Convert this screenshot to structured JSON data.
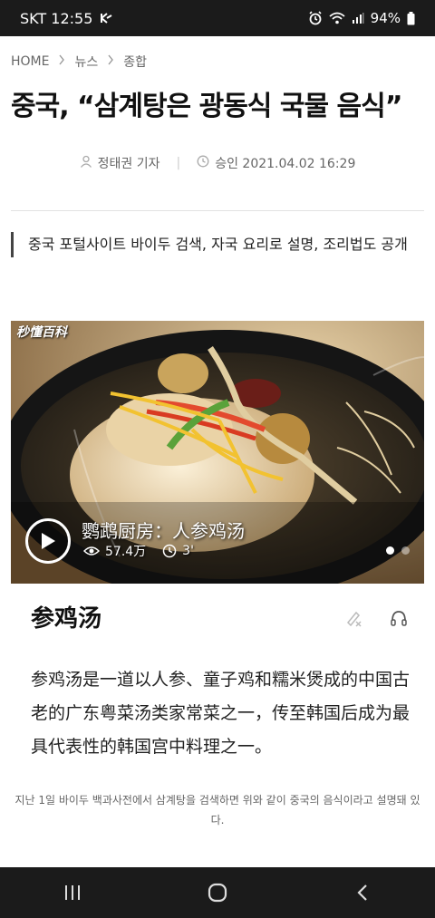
{
  "status_bar": {
    "carrier_time": "SKT 12:55",
    "battery": "94%"
  },
  "breadcrumb": [
    "HOME",
    "뉴스",
    "종합"
  ],
  "article": {
    "headline": "중국, “삼계탕은 광동식 국물 음식”",
    "author": "정태권 기자",
    "approved": "승인 2021.04.02 16:29",
    "subtitle": "중국 포털사이트 바이두 검색, 자국 요리로 설명, 조리법도 공개"
  },
  "video": {
    "logo": "秒懂百科",
    "title": "鹦鹉厨房：人参鸡汤",
    "views": "57.4万",
    "duration": "3'",
    "slide_count": 2,
    "active_slide": 1
  },
  "baike": {
    "title": "参鸡汤",
    "body": "参鸡汤是一道以人参、童子鸡和糯米煲成的中国古老的广东粤菜汤类家常菜之一，传至韩国后成为最具代表性的韩国宫中料理之一。"
  },
  "caption": "지난 1일 바이두 백과사전에서 삼계탕을 검색하면 위와 같이 중국의 음식이라고 설명돼 있다.",
  "icons": {
    "status_left": "kakao-style-app-icon",
    "status_right": [
      "alarm-icon",
      "wifi-icon",
      "signal-icon",
      "battery-icon"
    ],
    "card_tools": [
      "edit-icon",
      "headphones-icon"
    ],
    "nav": [
      "recent-apps-icon",
      "home-icon",
      "back-icon"
    ]
  }
}
